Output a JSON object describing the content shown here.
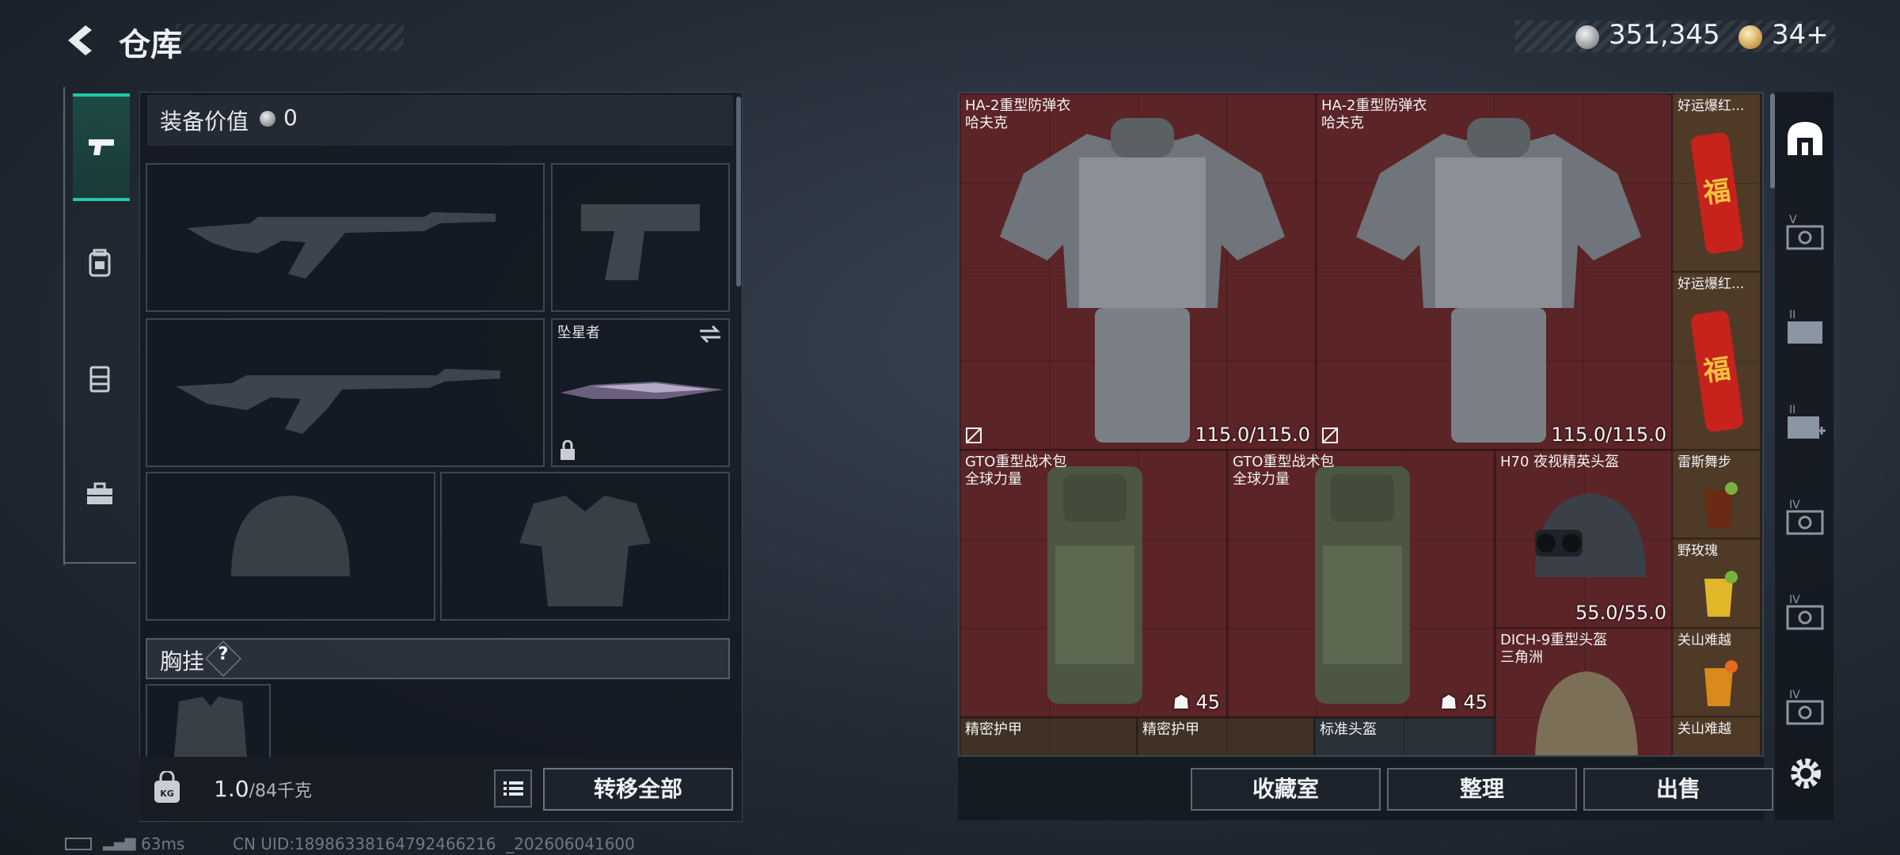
{
  "header": {
    "title": "仓库",
    "currency_value": "351,345",
    "token_value": "34+"
  },
  "left_nav": [
    "weapon-icon",
    "backpack-icon",
    "chest-rig-icon",
    "toolbox-icon"
  ],
  "loadout": {
    "value_label": "装备价值",
    "value_amount": "0",
    "melee_name": "坠星者",
    "chest_rig_label": "胸挂",
    "help_label": "?",
    "weight_value": "1.0",
    "weight_unit": "/84千克",
    "bag_badge": "KG",
    "transfer_all": "转移全部"
  },
  "storage": {
    "items": [
      {
        "name": "HA-2重型防弹衣",
        "sub": "哈夫克",
        "durability": "115.0/115.0"
      },
      {
        "name": "HA-2重型防弹衣",
        "sub": "哈夫克",
        "durability": "115.0/115.0"
      },
      {
        "name": "好运爆红..."
      },
      {
        "name": "好运爆红..."
      },
      {
        "name": "GTO重型战术包",
        "sub": "全球力量",
        "capacity": "45"
      },
      {
        "name": "GTO重型战术包",
        "sub": "全球力量",
        "capacity": "45"
      },
      {
        "name": "H70 夜视精英头盔",
        "durability": "55.0/55.0"
      },
      {
        "name": "雷斯舞步"
      },
      {
        "name": "野玫瑰"
      },
      {
        "name": "DICH-9重型头盔",
        "sub": "三角洲"
      },
      {
        "name": "关山难越"
      },
      {
        "name": "精密护甲"
      },
      {
        "name": "精密护甲"
      },
      {
        "name": "标准头盔"
      },
      {
        "name": "关山难越"
      }
    ]
  },
  "right_tabs": [
    "home-icon",
    "v-case-icon",
    "ii-case-icon",
    "ii-plus-case-icon",
    "iv-case-icon",
    "iv-case-icon",
    "iv-case-icon"
  ],
  "footer": {
    "collection": "收藏室",
    "sort": "整理",
    "sell": "出售"
  },
  "status": {
    "ping": "63ms",
    "uid": "CN UID:18986338164792466216  _202606041600"
  },
  "colors": {
    "accent": "#1ec9a8",
    "item_bg_red": "#5b2426",
    "item_bg_gold": "#4f3a28"
  }
}
